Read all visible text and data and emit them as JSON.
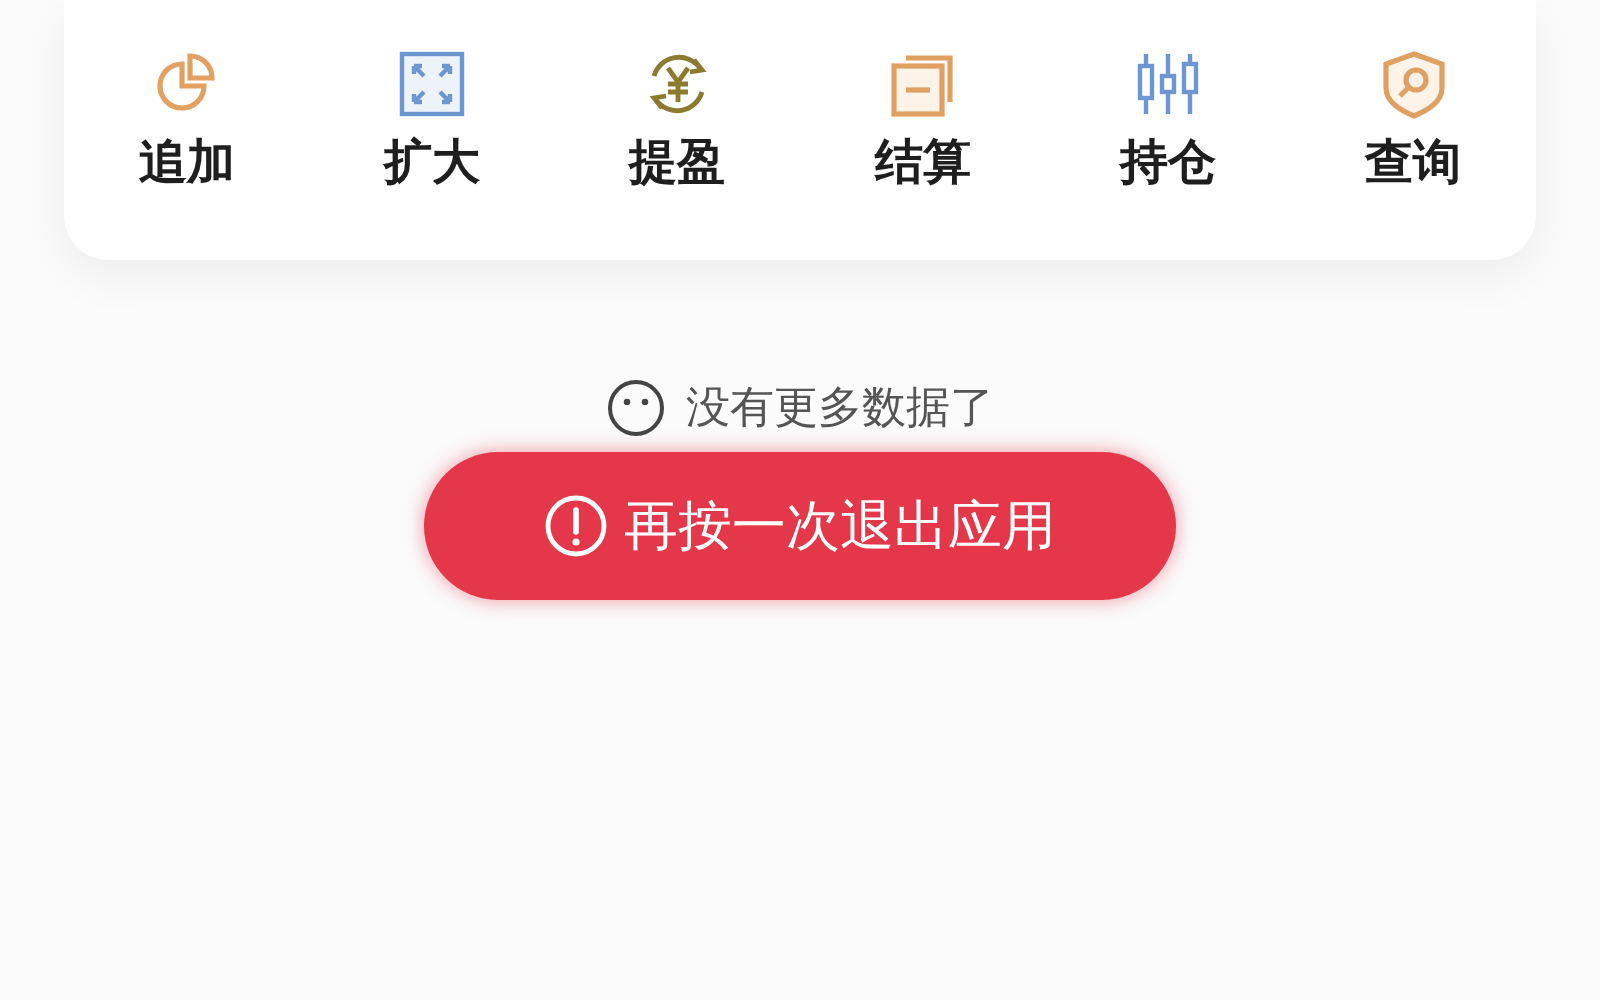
{
  "actions": [
    {
      "label": "追加"
    },
    {
      "label": "扩大"
    },
    {
      "label": "提盈"
    },
    {
      "label": "结算"
    },
    {
      "label": "持仓"
    },
    {
      "label": "查询"
    }
  ],
  "empty_message": "没有更多数据了",
  "toast": {
    "text": "再按一次退出应用"
  }
}
